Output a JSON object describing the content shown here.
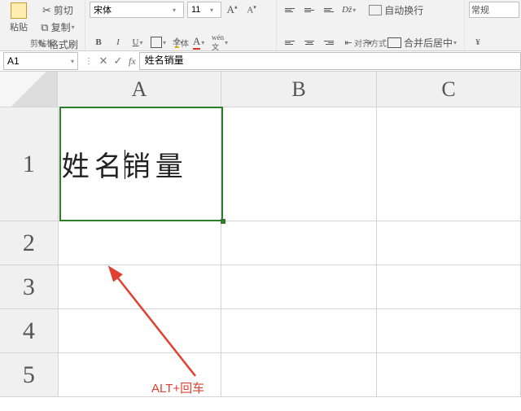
{
  "ribbon": {
    "clipboard": {
      "paste_label": "粘贴",
      "cut_label": "剪切",
      "copy_label": "复制",
      "format_painter_label": "格式刷",
      "group_label": "剪贴板"
    },
    "font": {
      "font_name": "宋体",
      "font_size": "11",
      "group_label": "字体"
    },
    "align": {
      "wrap_label": "自动换行",
      "merge_label": "合并后居中",
      "group_label": "对齐方式"
    },
    "style": {
      "normal_label": "常规"
    }
  },
  "fxbar": {
    "name_box": "A1",
    "fx_label": "fx",
    "formula": "姓名销量"
  },
  "columns": {
    "A": "A",
    "B": "B",
    "C": "C"
  },
  "rows": {
    "r1": "1",
    "r2": "2",
    "r3": "3",
    "r4": "4",
    "r5": "5"
  },
  "cells": {
    "A1_part1": "姓名",
    "A1_part2": "销量"
  },
  "annotation": {
    "tip": "ALT+回车"
  }
}
